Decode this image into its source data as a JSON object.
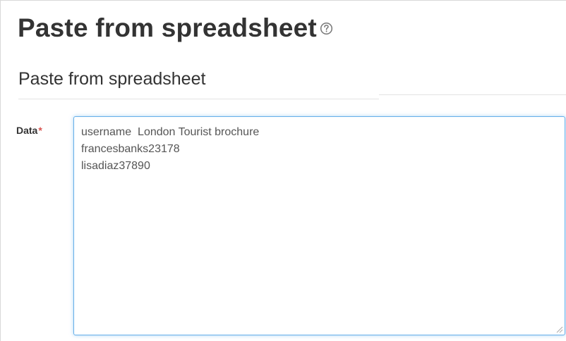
{
  "page": {
    "title": "Paste from spreadsheet",
    "help_icon": "question-circle-icon"
  },
  "form": {
    "section_heading": "Paste from spreadsheet",
    "data_field": {
      "label": "Data",
      "required_marker": "*",
      "value": "username  London Tourist brochure\nfrancesbanks23178\nlisadiaz37890"
    }
  },
  "colors": {
    "text": "#333333",
    "required": "#d9534f",
    "focus_border": "#66afe9"
  }
}
